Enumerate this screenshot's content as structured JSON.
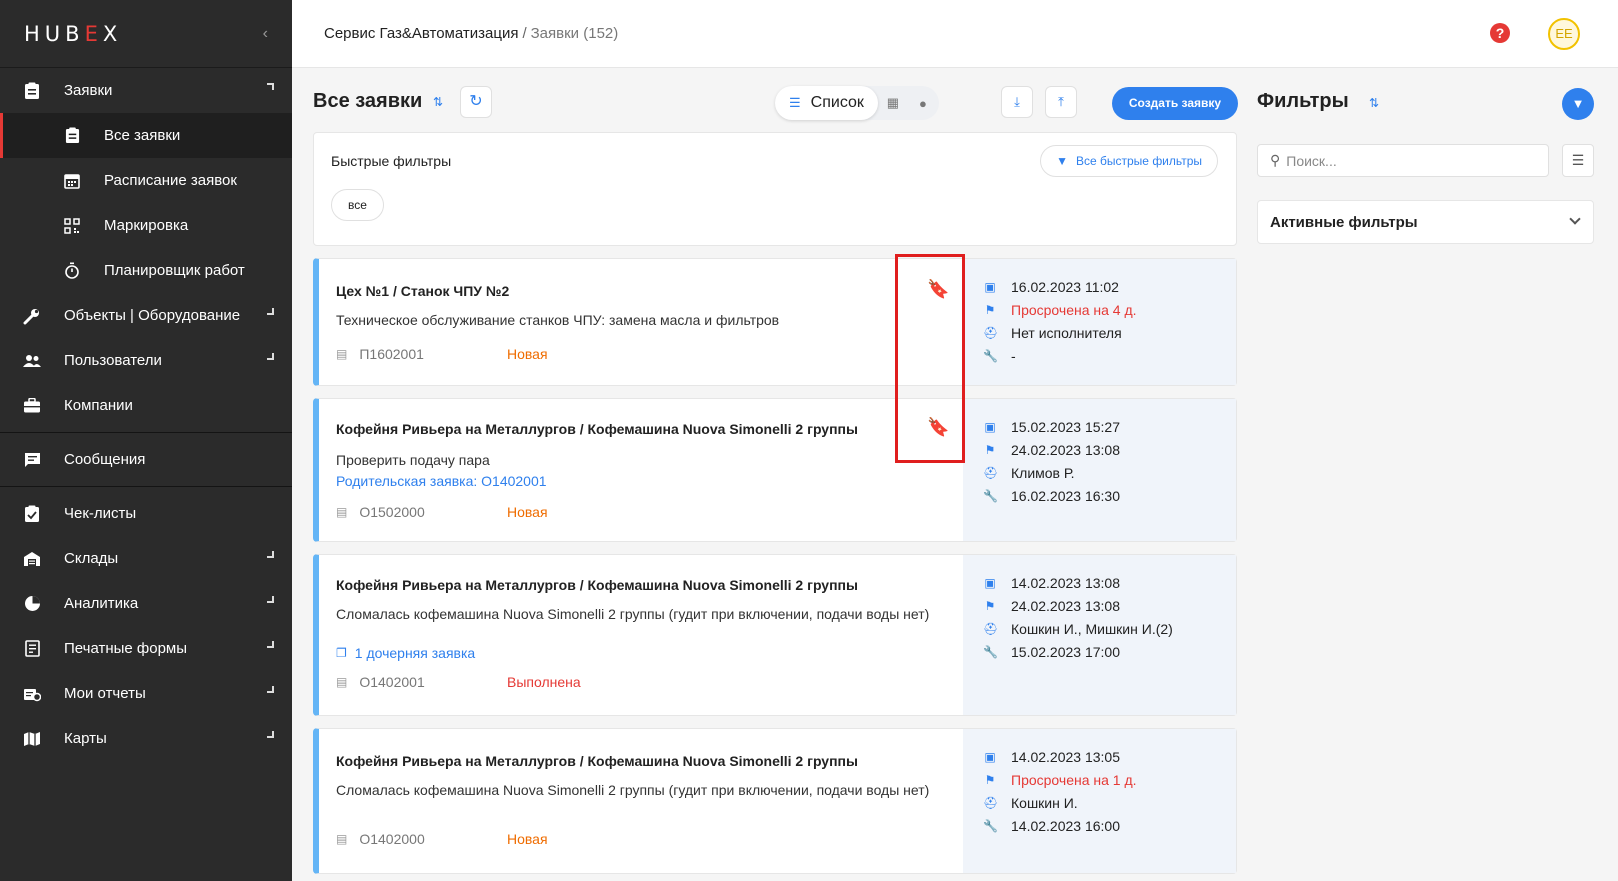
{
  "app": {
    "logo": "HUBEX",
    "logo_left": "HUB",
    "logo_x": "X",
    "logo_mid": "E",
    "collapse": "‹"
  },
  "sidebar": {
    "items": [
      {
        "label": "Заявки",
        "icon": "clipboard-icon"
      },
      {
        "label": "Все заявки",
        "icon": "clipboard-list-icon"
      },
      {
        "label": "Расписание заявок",
        "icon": "calendar-icon"
      },
      {
        "label": "Маркировка",
        "icon": "qr-code-icon"
      },
      {
        "label": "Планировщик работ",
        "icon": "stopwatch-icon"
      },
      {
        "label": "Объекты | Оборудование",
        "icon": "wrench-icon"
      },
      {
        "label": "Пользователи",
        "icon": "users-icon"
      },
      {
        "label": "Компании",
        "icon": "briefcase-icon"
      },
      {
        "label": "Сообщения",
        "icon": "chat-icon"
      },
      {
        "label": "Чек-листы",
        "icon": "checklist-icon"
      },
      {
        "label": "Склады",
        "icon": "warehouse-icon"
      },
      {
        "label": "Аналитика",
        "icon": "pie-chart-icon"
      },
      {
        "label": "Печатные формы",
        "icon": "print-form-icon"
      },
      {
        "label": "Мои отчеты",
        "icon": "report-icon"
      },
      {
        "label": "Карты",
        "icon": "map-icon"
      }
    ]
  },
  "header": {
    "breadcrumb_main": "Сервис Газ&Автоматизация",
    "breadcrumb_sep": "/",
    "breadcrumb_current": "Заявки (152)",
    "help": "?",
    "avatar": "EE"
  },
  "toolbar": {
    "title": "Все заявки",
    "view_list": "Список",
    "create": "Создать заявку"
  },
  "quick_filters": {
    "title": "Быстрые фильтры",
    "all_button": "Все быстрые фильтры",
    "chip": "все"
  },
  "cards": [
    {
      "title": "Цех №1 / Станок ЧПУ №2",
      "desc": "Техническое обслуживание станков ЧПУ: замена масла и фильтров",
      "link": "",
      "number": "П1602001",
      "status": "Новая",
      "created": "16.02.2023 11:02",
      "deadline": "Просрочена на 4 д.",
      "assignee": "Нет исполнителя",
      "work": "-"
    },
    {
      "title": "Кофейня Ривьера на Металлургов / Кофемашина Nuova Simonelli 2 группы",
      "desc": "Проверить подачу пара",
      "link": "Родительская заявка: О1402001",
      "number": "О1502000",
      "status": "Новая",
      "created": "15.02.2023 15:27",
      "deadline": "24.02.2023 13:08",
      "assignee": "Климов Р.",
      "work": "16.02.2023 16:30"
    },
    {
      "title": "Кофейня Ривьера на Металлургов / Кофемашина Nuova Simonelli 2 группы",
      "desc": "Сломалась кофемашина Nuova Simonelli 2 группы (гудит при включении, подачи воды нет)",
      "link": "1 дочерняя заявка",
      "number": "О1402001",
      "status": "Выполнена",
      "created": "14.02.2023 13:08",
      "deadline": "24.02.2023 13:08",
      "assignee": "Кошкин И., Мишкин И.(2)",
      "work": "15.02.2023 17:00"
    },
    {
      "title": "Кофейня Ривьера на Металлургов / Кофемашина Nuova Simonelli 2 группы",
      "desc": "Сломалась кофемашина Nuova Simonelli 2 группы (гудит при включении, подачи воды нет)",
      "link": "",
      "number": "О1402000",
      "status": "Новая",
      "created": "14.02.2023 13:05",
      "deadline": "Просрочена на 1 д.",
      "assignee": "Кошкин И.",
      "work": "14.02.2023 16:00"
    }
  ],
  "filters": {
    "title": "Фильтры",
    "search_placeholder": "Поиск...",
    "active_filters": "Активные фильтры"
  },
  "colors": {
    "accent": "#2f80ed",
    "sidebar": "#2b2b2b",
    "danger": "#e53935",
    "status_new": "#ef6c00",
    "bookmark": "#f2c200",
    "highlight": "#e01e1e"
  }
}
